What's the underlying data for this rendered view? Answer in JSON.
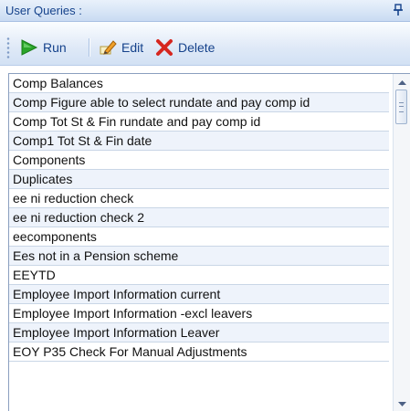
{
  "panel": {
    "title": "User Queries :",
    "pin_icon": "pin-icon"
  },
  "toolbar": {
    "run_label": "Run",
    "edit_label": "Edit",
    "delete_label": "Delete",
    "icons": {
      "run": "play-icon",
      "edit": "pencil-icon",
      "delete": "delete-x-icon"
    }
  },
  "colors": {
    "header_text": "#15428b",
    "alt_row": "#eef3fb",
    "run_green": "#2aa52a",
    "delete_red": "#d6261f"
  },
  "queries": [
    "Comp Balances",
    "Comp Figure able to select rundate and pay comp id",
    "Comp Tot St & Fin rundate and pay comp id",
    "Comp1 Tot St & Fin date",
    "Components",
    "Duplicates",
    "ee ni reduction check",
    "ee ni reduction check 2",
    "eecomponents",
    "Ees not in a Pension scheme",
    "EEYTD",
    "Employee Import Information current",
    "Employee Import Information -excl leavers",
    "Employee Import Information Leaver",
    "EOY P35 Check For Manual Adjustments"
  ]
}
